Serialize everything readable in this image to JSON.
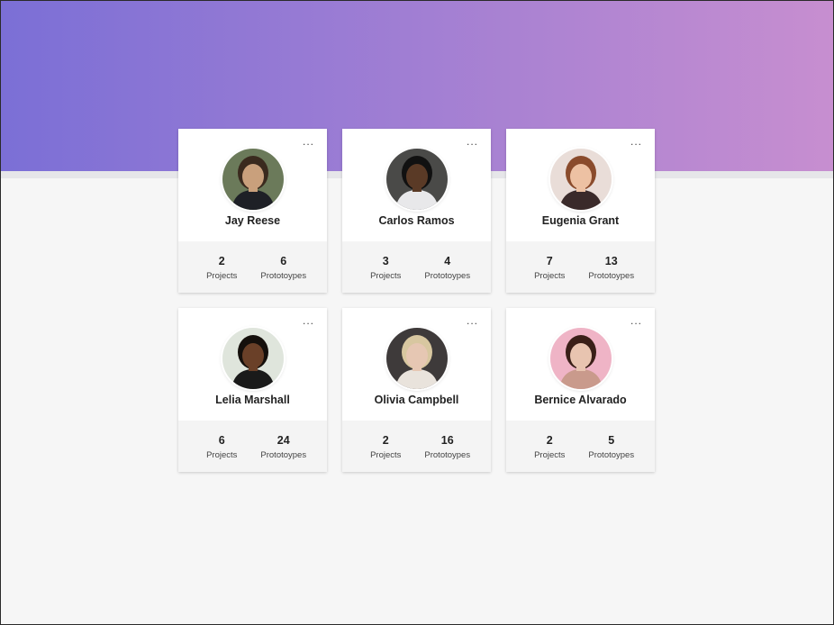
{
  "header": {
    "gradient_start": "#7b6fd6",
    "gradient_end": "#c78ed0"
  },
  "more_icon_label": "...",
  "cards": [
    {
      "name": "Jay Reese",
      "projects": "2",
      "prototypes": "6",
      "projects_label": "Projects",
      "prototypes_label": "Prototoypes",
      "avatar_bg": "#6b7a5a",
      "skin": "#c9a07c",
      "hair": "#3a2a1e",
      "shirt": "#1e2026"
    },
    {
      "name": "Carlos Ramos",
      "projects": "3",
      "prototypes": "4",
      "projects_label": "Projects",
      "prototypes_label": "Prototoypes",
      "avatar_bg": "#4a4a48",
      "skin": "#5a3a26",
      "hair": "#111111",
      "shirt": "#e8e8ea"
    },
    {
      "name": "Eugenia Grant",
      "projects": "7",
      "prototypes": "13",
      "projects_label": "Projects",
      "prototypes_label": "Prototoypes",
      "avatar_bg": "#e9ddd8",
      "skin": "#edc1a3",
      "hair": "#8a4b2c",
      "shirt": "#3a2a2a"
    },
    {
      "name": "Lelia Marshall",
      "projects": "6",
      "prototypes": "24",
      "projects_label": "Projects",
      "prototypes_label": "Prototoypes",
      "avatar_bg": "#dfe5dc",
      "skin": "#6a4028",
      "hair": "#15100c",
      "shirt": "#1a1a1a"
    },
    {
      "name": "Olivia Campbell",
      "projects": "2",
      "prototypes": "16",
      "projects_label": "Projects",
      "prototypes_label": "Prototoypes",
      "avatar_bg": "#3e3a3a",
      "skin": "#e6c7b3",
      "hair": "#d8c7a0",
      "shirt": "#e9e3dc"
    },
    {
      "name": "Bernice Alvarado",
      "projects": "2",
      "prototypes": "5",
      "projects_label": "Projects",
      "prototypes_label": "Prototoypes",
      "avatar_bg": "#efb4c6",
      "skin": "#e8c4b0",
      "hair": "#3a1f18",
      "shirt": "#c99a8c"
    }
  ]
}
